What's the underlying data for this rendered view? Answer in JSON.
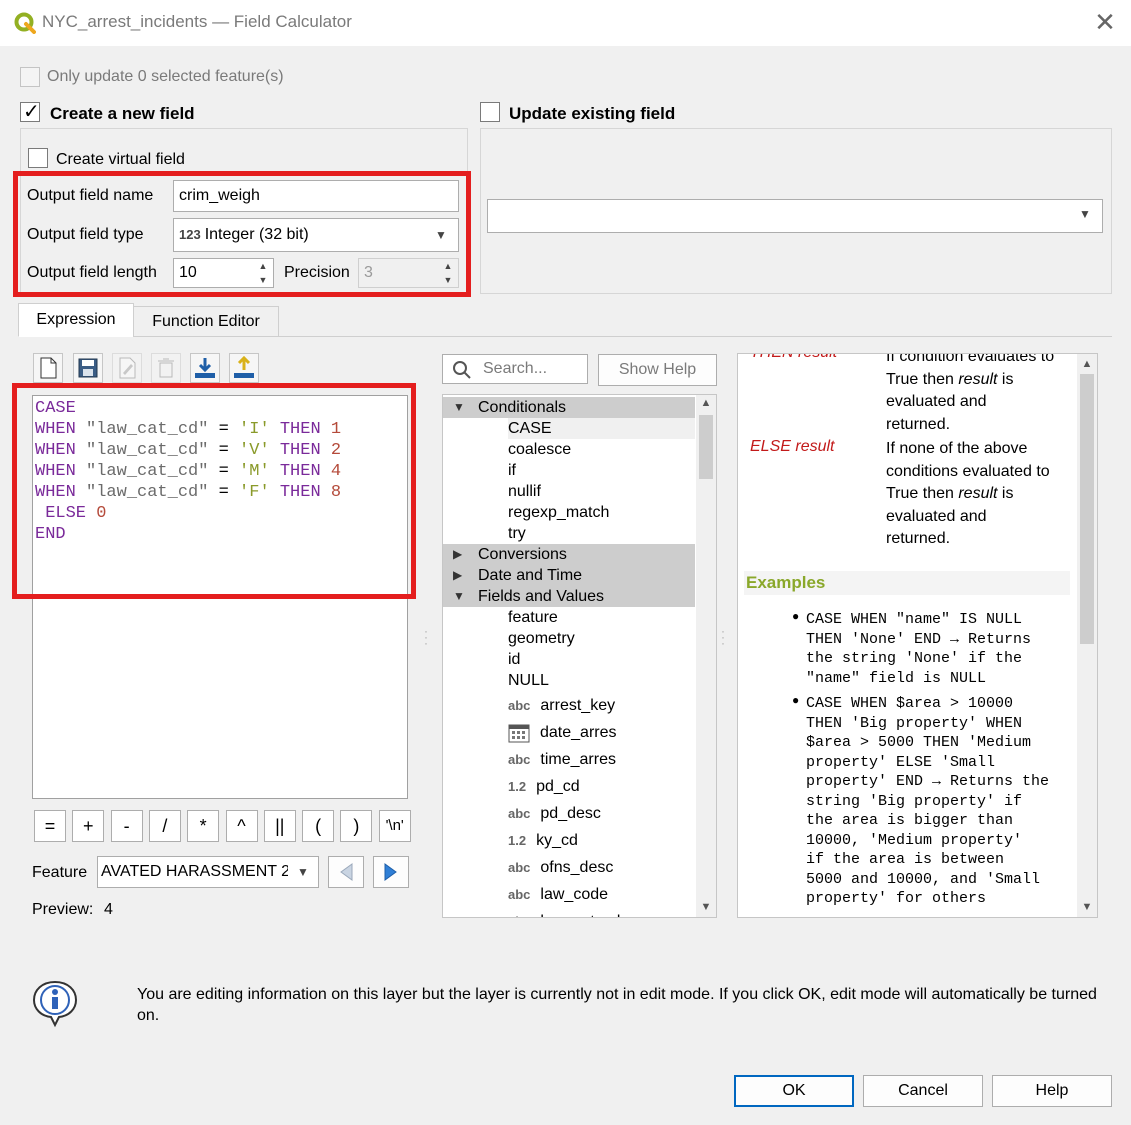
{
  "window": {
    "title": "NYC_arrest_incidents — Field Calculator"
  },
  "top": {
    "only_update_label": "Only update 0 selected feature(s)",
    "create_new_label": "Create a new field",
    "update_existing_label": "Update existing field",
    "virtual_field_label": "Create virtual field"
  },
  "output": {
    "name_label": "Output field name",
    "name_value": "crim_weigh",
    "type_label": "Output field type",
    "type_badge": "123",
    "type_value": "Integer (32 bit)",
    "length_label": "Output field length",
    "length_value": "10",
    "precision_label": "Precision",
    "precision_value": "3"
  },
  "tabs": [
    {
      "label": "Expression"
    },
    {
      "label": "Function Editor"
    }
  ],
  "expression": {
    "lines": [
      [
        [
          "kw",
          "CASE"
        ]
      ],
      [
        [
          "kw",
          "WHEN"
        ],
        [
          "t",
          " "
        ],
        [
          "fld",
          "\"law_cat_cd\""
        ],
        [
          "t",
          " = "
        ],
        [
          "str",
          "'I'"
        ],
        [
          "t",
          " "
        ],
        [
          "kw",
          "THEN"
        ],
        [
          "t",
          " "
        ],
        [
          "num",
          "1"
        ]
      ],
      [
        [
          "kw",
          "WHEN"
        ],
        [
          "t",
          " "
        ],
        [
          "fld",
          "\"law_cat_cd\""
        ],
        [
          "t",
          " = "
        ],
        [
          "str",
          "'V'"
        ],
        [
          "t",
          " "
        ],
        [
          "kw",
          "THEN"
        ],
        [
          "t",
          " "
        ],
        [
          "num",
          "2"
        ]
      ],
      [
        [
          "kw",
          "WHEN"
        ],
        [
          "t",
          " "
        ],
        [
          "fld",
          "\"law_cat_cd\""
        ],
        [
          "t",
          " = "
        ],
        [
          "str",
          "'M'"
        ],
        [
          "t",
          " "
        ],
        [
          "kw",
          "THEN"
        ],
        [
          "t",
          " "
        ],
        [
          "num",
          "4"
        ]
      ],
      [
        [
          "kw",
          "WHEN"
        ],
        [
          "t",
          " "
        ],
        [
          "fld",
          "\"law_cat_cd\""
        ],
        [
          "t",
          " = "
        ],
        [
          "str",
          "'F'"
        ],
        [
          "t",
          " "
        ],
        [
          "kw",
          "THEN"
        ],
        [
          "t",
          " "
        ],
        [
          "num",
          "8"
        ]
      ],
      [
        [
          "t",
          " "
        ],
        [
          "kw",
          "ELSE"
        ],
        [
          "t",
          " "
        ],
        [
          "num",
          "0"
        ]
      ],
      [
        [
          "kw",
          "END"
        ]
      ]
    ]
  },
  "operators": [
    "=",
    "+",
    "-",
    "/",
    "*",
    "^",
    "||",
    "(",
    ")",
    "'\\n'"
  ],
  "feature": {
    "label": "Feature",
    "value": "AVATED HARASSMENT 2"
  },
  "preview": {
    "label": "Preview:",
    "value": "4"
  },
  "search": {
    "placeholder": "Search...",
    "show_help_label": "Show Help"
  },
  "functions": {
    "conditionals": "Conditionals",
    "cond_items": [
      "CASE",
      "coalesce",
      "if",
      "nullif",
      "regexp_match",
      "try"
    ],
    "conversions": "Conversions",
    "datetime": "Date and Time",
    "fields": "Fields and Values",
    "field_items_plain": [
      "feature",
      "geometry",
      "id",
      "NULL"
    ],
    "field_items": [
      {
        "badge": "abc",
        "name": "arrest_key"
      },
      {
        "badge": "cal",
        "name": "date_arres"
      },
      {
        "badge": "abc",
        "name": "time_arres"
      },
      {
        "badge": "1.2",
        "name": "pd_cd"
      },
      {
        "badge": "abc",
        "name": "pd_desc"
      },
      {
        "badge": "1.2",
        "name": "ky_cd"
      },
      {
        "badge": "abc",
        "name": "ofns_desc"
      },
      {
        "badge": "abc",
        "name": "law_code"
      },
      {
        "badge": "abc",
        "name": "law_cat_cd"
      }
    ]
  },
  "help": {
    "then_term": "THEN result",
    "then_desc_1": "If condition evaluates to",
    "then_desc_2a": "True then ",
    "then_desc_2b": "result",
    "then_desc_2c": " is",
    "then_desc_3": "evaluated and",
    "then_desc_4": "returned.",
    "else_term": "ELSE result",
    "else_desc_1": "If none of the above",
    "else_desc_2": "conditions evaluated to",
    "else_desc_3a": "True then ",
    "else_desc_3b": "result",
    "else_desc_3c": " is",
    "else_desc_4": "evaluated and",
    "else_desc_5": "returned.",
    "examples_heading": "Examples",
    "ex1": [
      "CASE WHEN \"name\" IS NULL",
      "THEN 'None' END → Returns",
      "the string 'None' if the",
      "\"name\" field is NULL"
    ],
    "ex2": [
      "CASE WHEN $area > 10000",
      "THEN 'Big property' WHEN",
      "$area > 5000 THEN 'Medium",
      "property' ELSE 'Small",
      "property' END → Returns the",
      "string 'Big property' if",
      "the area is bigger than",
      "10000, 'Medium property'",
      "if the area is between",
      "5000 and 10000, and 'Small",
      "property' for others"
    ]
  },
  "info": {
    "message": "You are editing information on this layer but the layer is currently not in edit mode. If you click OK, edit mode will automatically be turned on."
  },
  "buttons": {
    "ok": "OK",
    "cancel": "Cancel",
    "help": "Help"
  },
  "colors": {
    "highlight": "#e41e1e",
    "group_row": "#cdcdcd",
    "examples": "#8aa82a"
  }
}
